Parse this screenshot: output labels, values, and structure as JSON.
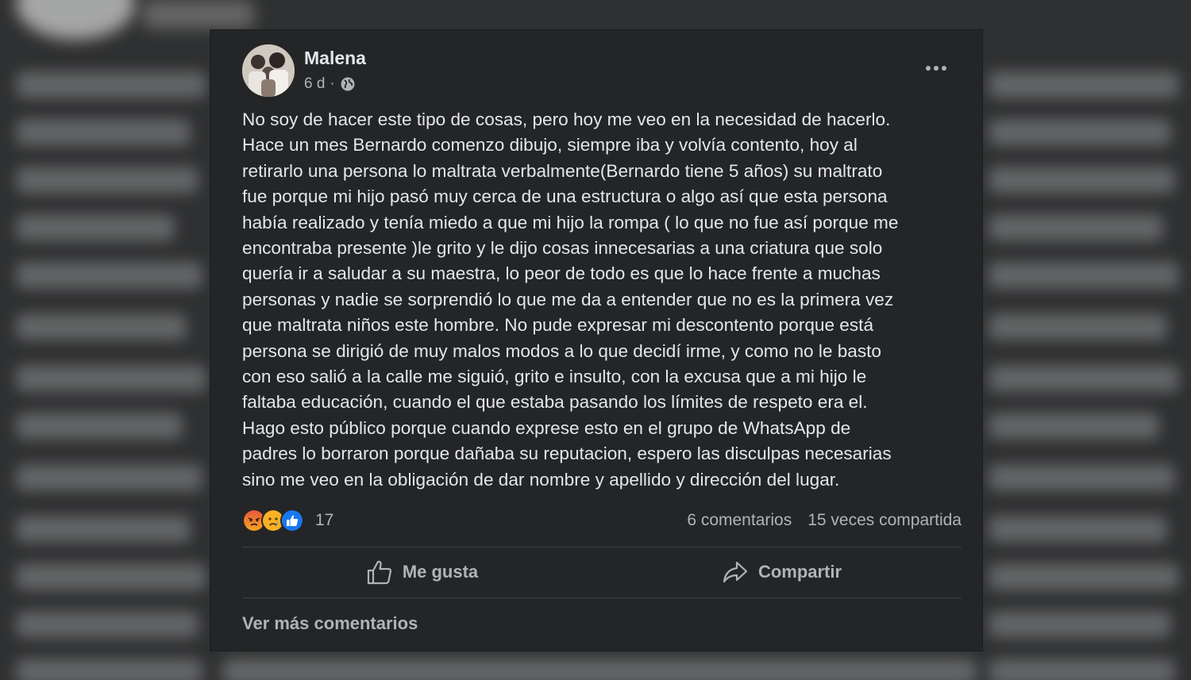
{
  "post": {
    "author": "Malena",
    "time": "6 d",
    "separator": "·",
    "text_lines": [
      "No soy de hacer este tipo de cosas, pero hoy me veo en la necesidad de hacerlo.",
      "Hace un mes Bernardo comenzo dibujo, siempre iba y volvía contento, hoy al",
      "retirarlo una persona lo maltrata verbalmente(Bernardo tiene 5 años) su maltrato",
      "fue porque mi hijo pasó muy cerca de una estructura o algo así que esta persona",
      "había realizado y tenía miedo a que mi hijo la rompa ( lo que no fue así porque me",
      "encontraba presente )le grito y le dijo cosas innecesarias  a una criatura que solo",
      "quería ir a saludar a su maestra, lo peor de todo es que lo hace frente a muchas",
      "personas y nadie se sorprendió lo que me da a entender que no es la primera vez",
      "que maltrata niños este hombre.  No pude expresar mi descontento porque está",
      "persona se dirigió de muy malos modos a lo que decidí irme, y  como no le basto",
      "con eso salió a la calle me siguió, grito e insulto, con la excusa que a mi hijo le",
      "faltaba educación, cuando el que estaba pasando los límites de respeto era el.",
      "Hago esto público porque cuando exprese esto en el  grupo de WhatsApp de",
      "padres lo borraron porque dañaba su reputacion, espero las disculpas necesarias",
      "sino me veo en la obligación de dar nombre y apellido y dirección del lugar."
    ],
    "reaction_count": "17",
    "reactions": [
      "angry-icon",
      "sad-icon",
      "like-icon"
    ],
    "comments": "6 comentarios",
    "shares": "15 veces compartida"
  },
  "actions": {
    "like_label": "Me gusta",
    "share_label": "Compartir"
  },
  "more_comments": "Ver más comentarios",
  "colors": {
    "card_bg": "#242526",
    "text": "#e4e6eb",
    "secondary_text": "#b0b3b8",
    "like_blue": "#1877f2",
    "angry_red": "#e9573f",
    "sad_yellow": "#f7b125"
  }
}
